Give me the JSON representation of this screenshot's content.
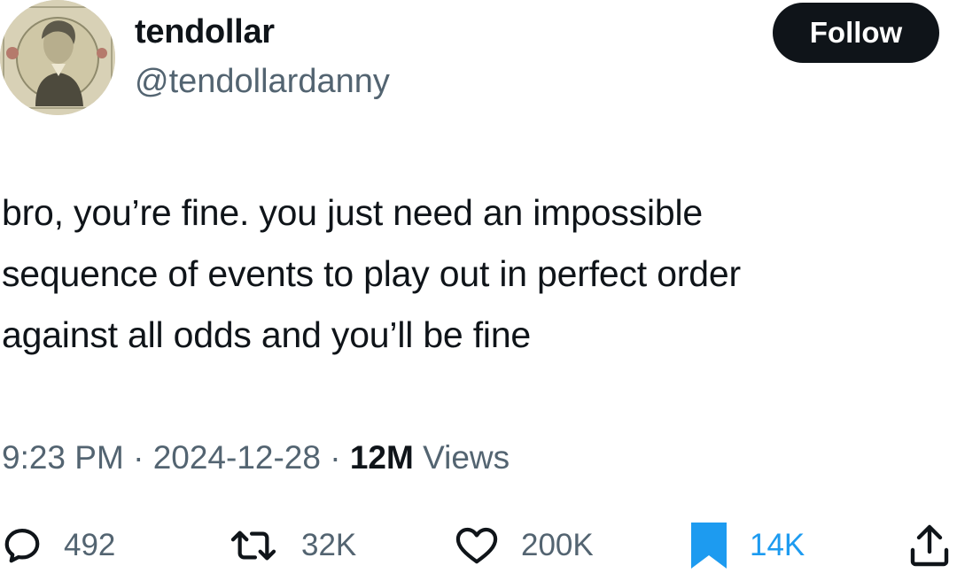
{
  "user": {
    "display_name": "tendollar",
    "handle": "@tendollardanny",
    "avatar_icon": "ten-dollar-bill-portrait"
  },
  "follow_label": "Follow",
  "tweet": {
    "text": "bro, you’re fine. you just need an impossible\nsequence of events to play out in perfect order\nagainst all odds and you’ll be fine"
  },
  "meta": {
    "time": "9:23 PM",
    "separator": " · ",
    "date": "2024-12-28",
    "views_count": "12M",
    "views_label": "Views"
  },
  "actions": {
    "replies": "492",
    "reposts": "32K",
    "likes": "200K",
    "bookmarks": "14K"
  },
  "colors": {
    "text": "#0f1419",
    "secondary": "#536471",
    "accent": "#1d9bf0",
    "follow_bg": "#0f1419"
  }
}
